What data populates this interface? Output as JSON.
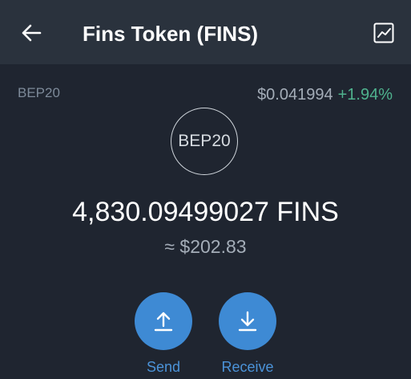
{
  "header": {
    "title": "Fins Token (FINS)",
    "back_icon": "arrow-left-icon",
    "chart_icon": "line-chart-icon"
  },
  "token": {
    "network": "BEP20",
    "price": "$0.041994",
    "change": "+1.94%",
    "logo_text": "BEP20",
    "balance": "4,830.09499027 FINS",
    "fiat_value": "≈ $202.83"
  },
  "actions": {
    "send_label": "Send",
    "send_icon": "arrow-up-icon",
    "receive_label": "Receive",
    "receive_icon": "arrow-down-icon"
  },
  "colors": {
    "header_bg": "#2a323d",
    "background": "#1f2530",
    "accent": "#3e8ad4",
    "positive": "#4fb38e"
  }
}
